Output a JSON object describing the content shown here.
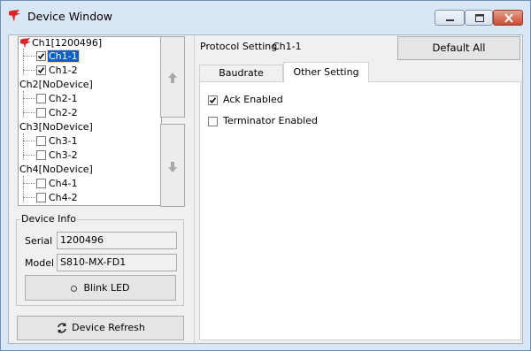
{
  "window": {
    "title": "Device Window",
    "icon": "red-firebird-logo",
    "controls": {
      "minimize": "minimize-icon",
      "maximize": "maximize-icon",
      "close": "close-icon"
    }
  },
  "tree": {
    "nodes": [
      {
        "label": "Ch1[1200496]",
        "icon": "red-device-icon",
        "children": [
          {
            "label": "Ch1-1",
            "checked": true,
            "selected": true
          },
          {
            "label": "Ch1-2",
            "checked": true,
            "selected": false
          }
        ]
      },
      {
        "label": "Ch2[NoDevice]",
        "children": [
          {
            "label": "Ch2-1",
            "checked": false
          },
          {
            "label": "Ch2-2",
            "checked": false
          }
        ]
      },
      {
        "label": "Ch3[NoDevice]",
        "children": [
          {
            "label": "Ch3-1",
            "checked": false
          },
          {
            "label": "Ch3-2",
            "checked": false
          }
        ]
      },
      {
        "label": "Ch4[NoDevice]",
        "children": [
          {
            "label": "Ch4-1",
            "checked": false
          },
          {
            "label": "Ch4-2",
            "checked": false
          }
        ]
      }
    ]
  },
  "move_buttons": {
    "up_icon": "arrow-up-icon",
    "down_icon": "arrow-down-icon"
  },
  "device_info": {
    "title": "Device Info",
    "serial_label": "Serial",
    "serial_value": "1200496",
    "model_label": "Model",
    "model_value": "S810-MX-FD1",
    "blink_label": "Blink LED"
  },
  "device_refresh_label": "Device Refresh",
  "protocol": {
    "title": "Protocol Setting",
    "channel": "Ch1-1",
    "default_all_label": "Default All",
    "tabs": [
      {
        "label": "Baudrate",
        "active": false
      },
      {
        "label": "Other Setting",
        "active": true
      }
    ],
    "options": [
      {
        "label": "Ack Enabled",
        "checked": true
      },
      {
        "label": "Terminator Enabled",
        "checked": false
      }
    ]
  },
  "colors": {
    "titlebar": "#d9e6f4",
    "selection": "#0a5fc8",
    "close_button": "#c94a34"
  }
}
